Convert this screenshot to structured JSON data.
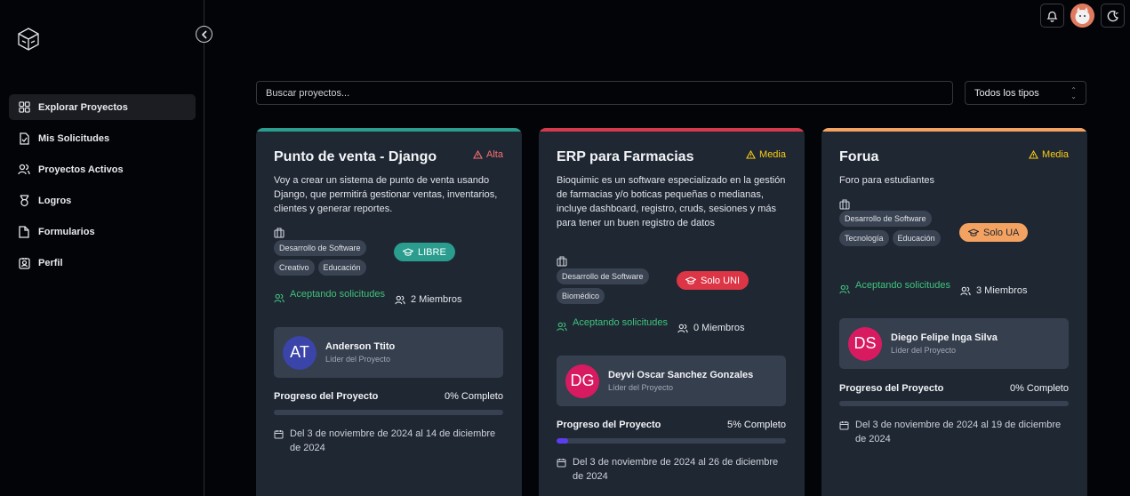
{
  "sidebar": {
    "items": [
      {
        "label": "Explorar Proyectos",
        "icon": "grid-icon",
        "active": true
      },
      {
        "label": "Mis Solicitudes",
        "icon": "file-check-icon"
      },
      {
        "label": "Proyectos Activos",
        "icon": "users-icon"
      },
      {
        "label": "Logros",
        "icon": "medal-icon"
      },
      {
        "label": "Formularios",
        "icon": "file-icon"
      },
      {
        "label": "Perfil",
        "icon": "user-badge-icon"
      }
    ]
  },
  "search": {
    "placeholder": "Buscar proyectos..."
  },
  "filter": {
    "value": "Todos los tipos"
  },
  "projects": [
    {
      "title": "Punto de venta - Django",
      "priority": "Alta",
      "priority_color": "#f87171",
      "accent": "#2a9d8f",
      "description": "Voy a crear un sistema de punto de venta usando Django, que permitirá gestionar ventas, inventarios, clientes y generar reportes.",
      "tags": [
        "Desarrollo de Software",
        "Creativo",
        "Educación"
      ],
      "badge": "LIBRE",
      "badge_color": "#2a9d8f",
      "status": "Aceptando solicitudes",
      "members": "2 Miembros",
      "leader_initials": "AT",
      "leader_color": "#3b44a8",
      "leader_name": "Anderson Ttito",
      "leader_role": "Líder del Proyecto",
      "progress_label": "Progreso del Proyecto",
      "progress_text": "0% Completo",
      "progress": 0,
      "dates": "Del 3 de noviembre de 2024 al 14 de diciembre de 2024"
    },
    {
      "title": "ERP para Farmacias",
      "priority": "Media",
      "priority_color": "#facc15",
      "accent": "#d6394b",
      "description": "Bioquimic es un software especializado en la gestión de farmacias y/o boticas pequeñas o medianas, incluye dashboard, registro, cruds, sesiones y más para tener un buen registro de datos",
      "tags": [
        "Desarrollo de Software",
        "Biomédico"
      ],
      "badge": "Solo UNI",
      "badge_color": "#dc3545",
      "status": "Aceptando solicitudes",
      "members": "0 Miembros",
      "leader_initials": "DG",
      "leader_color": "#d81b60",
      "leader_name": "Deyvi Oscar Sanchez Gonzales",
      "leader_role": "Líder del Proyecto",
      "progress_label": "Progreso del Proyecto",
      "progress_text": "5% Completo",
      "progress": 5,
      "dates": "Del 3 de noviembre de 2024 al 26 de diciembre de 2024"
    },
    {
      "title": "Forua",
      "priority": "Media",
      "priority_color": "#facc15",
      "accent": "#f4a261",
      "description": "Foro para estudiantes",
      "tags": [
        "Desarrollo de Software",
        "Tecnología",
        "Educación"
      ],
      "badge": "Solo UA",
      "badge_color": "#f4a261",
      "status": "Aceptando solicitudes",
      "members": "3 Miembros",
      "leader_initials": "DS",
      "leader_color": "#d81b60",
      "leader_name": "Diego Felipe Inga Silva",
      "leader_role": "Líder del Proyecto",
      "progress_label": "Progreso del Proyecto",
      "progress_text": "0% Completo",
      "progress": 0,
      "dates": "Del 3 de noviembre de 2024 al 19 de diciembre de 2024"
    }
  ]
}
